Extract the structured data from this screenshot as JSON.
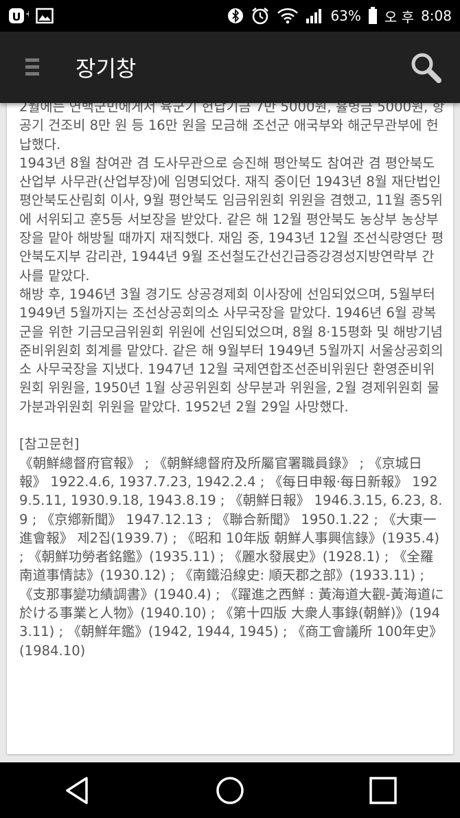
{
  "status": {
    "battery": "63%",
    "ampm": "오 후",
    "time": "8:08",
    "icons": [
      "carrier-u-icon",
      "gallery-icon",
      "bluetooth-icon",
      "alarm-icon",
      "wifi-icon",
      "signal-icon",
      "battery-icon"
    ]
  },
  "app_bar": {
    "title": "장기창",
    "icons": [
      "menu-icon",
      "search-icon"
    ]
  },
  "article": {
    "body": "2월에는 연백군민에게서 육군기 헌납기금 7만 5000원, 휼병금 5000원, 항공기 건조비 8만 원 등 16만 원을 모금해 조선군 애국부와 해군무관부에 헌납했다.\n1943년 8월 참여관 겸 도사무관으로 승진해 평안북도 참여관 겸 평안북도 산업부 사무관(산업부장)에 임명되었다. 재직 중이던 1943년 8월 재단법인 평안북도산림회 이사, 9월 평안북도 임금위원회 위원을 겸했고, 11월 종5위에 서위되고 훈5등 서보장을 받았다. 같은 해 12월 평안북도 농상부 농상부장을 맡아 해방될 때까지 재직했다. 재임 중, 1943년 12월 조선식량영단 평안북도지부 감리관, 1944년 9월 조선철도간선긴급증강경성지방연락부 간사를 맡았다.\n해방 후, 1946년 3월 경기도 상공경제회 이사장에 선임되었으며, 5월부터 1949년 5월까지는 조선상공회의소 사무국장을 맡았다. 1946년 6월 광복군을 위한 기금모금위원회 위원에 선임되었으며, 8월 8·15평화 및 해방기념준비위원회 회계를 맡았다. 같은 해 9월부터 1949년 5월까지 서울상공회의소 사무국장을 지냈다. 1947년 12월 국제연합조선준비위원단 환영준비위원회 위원을, 1950년 1월 상공위원회 상무분과 위원을, 2월 경제위원회 물가분과위원회 위원을 맡았다. 1952년 2월 29일 사망했다.",
    "references_heading": "[참고문헌]",
    "references": "《朝鮮總督府官報》 ; 《朝鮮總督府及所屬官署職員錄》 ; 《京城日報》 1922.4.6, 1937.7.23, 1942.2.4 ; 《每日申報·每日新報》 1929.5.11, 1930.9.18, 1943.8.19 ; 《朝鮮日報》 1946.3.15, 6.23, 8.9 ; 《京鄕新聞》 1947.12.13 ; 《聯合新聞》 1950.1.22 ; 《大東一進會報》 제2집(1939.7) ; 《昭和 10年版 朝鮮人事興信錄》(1935.4) ; 《朝鮮功勞者銘鑑》(1935.11) ; 《麗水發展史》(1928.1) ; 《全羅南道事情誌》(1930.12) ; 《南鐵沿線史: 順天郡之部》(1933.11) ; 《支那事變功績調書》(1940.4) ; 《躍進之西鮮 : 黃海道大觀-黃海道に於ける事業と人物》(1940.10) ; 《第十四版 大衆人事錄(朝鮮)》(1943.11) ; 《朝鮮年鑑》(1942, 1944, 1945) ; 《商工會議所 100年史》(1984.10)"
  },
  "nav": {
    "icons": [
      "back-icon",
      "home-icon",
      "recents-icon"
    ]
  }
}
